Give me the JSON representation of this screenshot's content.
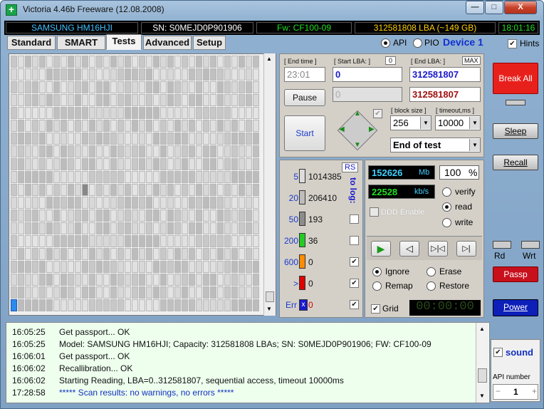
{
  "window": {
    "title": "Victoria 4.46b Freeware (12.08.2008)",
    "minimize": "—",
    "maximize": "□",
    "close": "X"
  },
  "info": {
    "model": "SAMSUNG HM16HJI",
    "serial": "SN: S0MEJD0P901906",
    "firmware": "Fw: CF100-09",
    "lba": "312581808 LBA (~149 GB)",
    "time": "18:01:16"
  },
  "tabs": [
    "Standard",
    "SMART",
    "Tests",
    "Advanced",
    "Setup"
  ],
  "mode": {
    "api": "API",
    "pio": "PIO",
    "device": "Device 1",
    "hints": "Hints"
  },
  "controls": {
    "end_time_label": "[ End time ]",
    "end_time": "23:01",
    "start_lba_label": "[ Start LBA: ]",
    "start_lba_badge": "0",
    "start_lba": "0",
    "end_lba_label": "[ End LBA: ]",
    "end_lba_badge": "MAX",
    "end_lba": "312581807",
    "pos_value": "0",
    "end_lba2": "312581807",
    "pause": "Pause",
    "start": "Start",
    "block_size_label": "[ block size ]",
    "block_size": "256",
    "timeout_label": "[ timeout,ms ]",
    "timeout": "10000",
    "end_action": "End of test"
  },
  "stats": {
    "rs": "RS",
    "to_log": "to log:",
    "rows": [
      {
        "label": "5",
        "count": "1014385",
        "color": "#dcdcdc"
      },
      {
        "label": "20",
        "count": "206410",
        "color": "#bdbdbd"
      },
      {
        "label": "50",
        "count": "193",
        "color": "#8c8c8c"
      },
      {
        "label": "200",
        "count": "36",
        "color": "#22cc22"
      },
      {
        "label": "600",
        "count": "0",
        "color": "#ff8c00"
      },
      {
        "label": ">",
        "count": "0",
        "color": "#e00000"
      },
      {
        "label": "Err",
        "count": "0",
        "color": "#1a1acc"
      }
    ]
  },
  "progress": {
    "mb_value": "152626",
    "mb_unit": "Mb",
    "percent": "100",
    "percent_unit": "%",
    "speed_value": "22528",
    "speed_unit": "kb/s",
    "ddd": "DDD Enable",
    "verify": "verify",
    "read": "read",
    "write": "write",
    "ignore": "Ignore",
    "erase": "Erase",
    "remap": "Remap",
    "restore": "Restore",
    "grid": "Grid",
    "timer": "00:00:00"
  },
  "log": [
    {
      "time": "16:05:25",
      "text": "Get passport... OK",
      "color": "#111111"
    },
    {
      "time": "16:05:25",
      "text": "Model: SAMSUNG HM16HJI; Capacity: 312581808 LBAs; SN: S0MEJD0P901906; FW: CF100-09",
      "color": "#111111"
    },
    {
      "time": "16:06:01",
      "text": "Get passport... OK",
      "color": "#111111"
    },
    {
      "time": "16:06:02",
      "text": "Recallibration... OK",
      "color": "#111111"
    },
    {
      "time": "16:06:02",
      "text": "Starting Reading, LBA=0..312581807, sequential access, timeout 10000ms",
      "color": "#111111"
    },
    {
      "time": "17:28:58",
      "text": "***** Scan results: no warnings, no errors *****",
      "color": "#1030c0"
    }
  ],
  "side": {
    "break_all": "Break All",
    "sleep": "Sleep",
    "recall": "Recall",
    "rd": "Rd",
    "wrt": "Wrt",
    "passp": "Passp",
    "power": "Power",
    "sound": "sound",
    "api_number_label": "API number",
    "api_number": "1",
    "minus": "−",
    "plus": "+"
  }
}
